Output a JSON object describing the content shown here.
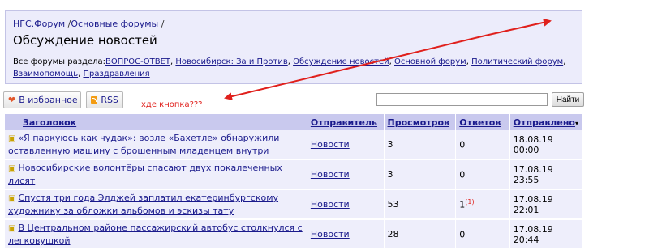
{
  "breadcrumb": {
    "items": [
      "НГС.Форум",
      "Основные форумы"
    ],
    "separator": "/"
  },
  "page_title": "Обсуждение новостей",
  "forums": {
    "label": "Все форумы раздела:",
    "links": [
      "ВОПРОС-ОТВЕТ",
      "Новосибирск: За и Против",
      "Обсуждение новостей",
      "Основной форум",
      "Политический форум",
      "Взаимопомощь",
      "Праздравления"
    ]
  },
  "toolbar": {
    "favorites_label": "В избранное",
    "rss_label": "RSS"
  },
  "annotation": {
    "text": "хде кнопка???",
    "color": "#e0201c"
  },
  "search": {
    "value": "",
    "button_label": "Найти"
  },
  "table": {
    "headers": [
      "Заголовок",
      "Отправитель",
      "Просмотров",
      "Ответов",
      "Отправлено"
    ],
    "sort_indicator": "▾",
    "rows": [
      {
        "title": "«Я паркуюсь как чудак»: возле «Бахетле» обнаружили оставленную машину с брошенным младенцем внутри",
        "sender": "Новости",
        "views": "3",
        "replies": "0",
        "new": "",
        "date": "18.08.19 00:00"
      },
      {
        "title": "Новосибирские волонтёры спасают двух покалеченных лисят",
        "sender": "Новости",
        "views": "3",
        "replies": "0",
        "new": "",
        "date": "17.08.19 23:55"
      },
      {
        "title": "Спустя три года Элджей заплатил екатеринбургскому художнику за обложки альбомов и эскизы тату",
        "sender": "Новости",
        "views": "53",
        "replies": "1",
        "new": "(1)",
        "date": "17.08.19 22:01"
      },
      {
        "title": "В Центральном районе пассажирский автобус столкнулся с легковушкой",
        "sender": "Новости",
        "views": "28",
        "replies": "0",
        "new": "",
        "date": "17.08.19 20:44"
      }
    ]
  },
  "icons": {
    "favorites": "heart-icon",
    "rss": "rss-icon",
    "topic": "book-icon",
    "colors": {
      "heart": "#e2572b",
      "rss": "#f39c12",
      "arrow": "#e0201c"
    }
  }
}
